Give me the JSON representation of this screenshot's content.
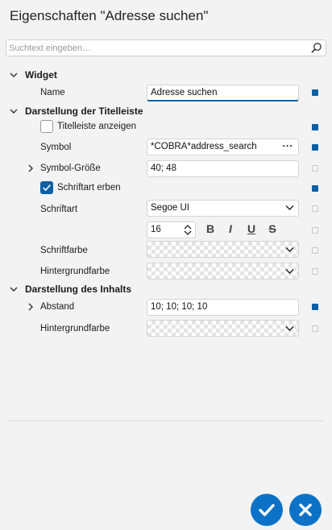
{
  "window": {
    "title": "Eigenschaften \"Adresse suchen\""
  },
  "search": {
    "placeholder": "Suchtext eingeben…",
    "value": ""
  },
  "sections": {
    "widget": {
      "label": "Widget",
      "name": {
        "label": "Name",
        "value": "Adresse suchen"
      }
    },
    "title_bar": {
      "label": "Darstellung der Titelleiste",
      "show_title_bar": {
        "label": "Titelleiste anzeigen",
        "checked": false
      },
      "symbol": {
        "label": "Symbol",
        "value": "*COBRA*address_search",
        "button": "···"
      },
      "symbol_size": {
        "label": "Symbol-Größe",
        "value": "40; 48"
      },
      "inherit_font": {
        "label": "Schriftart erben",
        "checked": true
      },
      "font": {
        "label": "Schriftart",
        "value": "Segoe UI",
        "size": "16",
        "bold": "B",
        "italic": "I",
        "underline": "U",
        "strike": "S"
      },
      "font_color": {
        "label": "Schriftfarbe"
      },
      "background_color": {
        "label": "Hintergrundfarbe"
      }
    },
    "content": {
      "label": "Darstellung des Inhalts",
      "padding": {
        "label": "Abstand",
        "value": "10; 10; 10; 10"
      },
      "background_color": {
        "label": "Hintergrundfarbe"
      }
    }
  },
  "colors": {
    "accent": "#0b5fa5",
    "button": "#0b72c7"
  },
  "footer": {
    "ok_icon": "check-icon",
    "cancel_icon": "close-icon"
  }
}
